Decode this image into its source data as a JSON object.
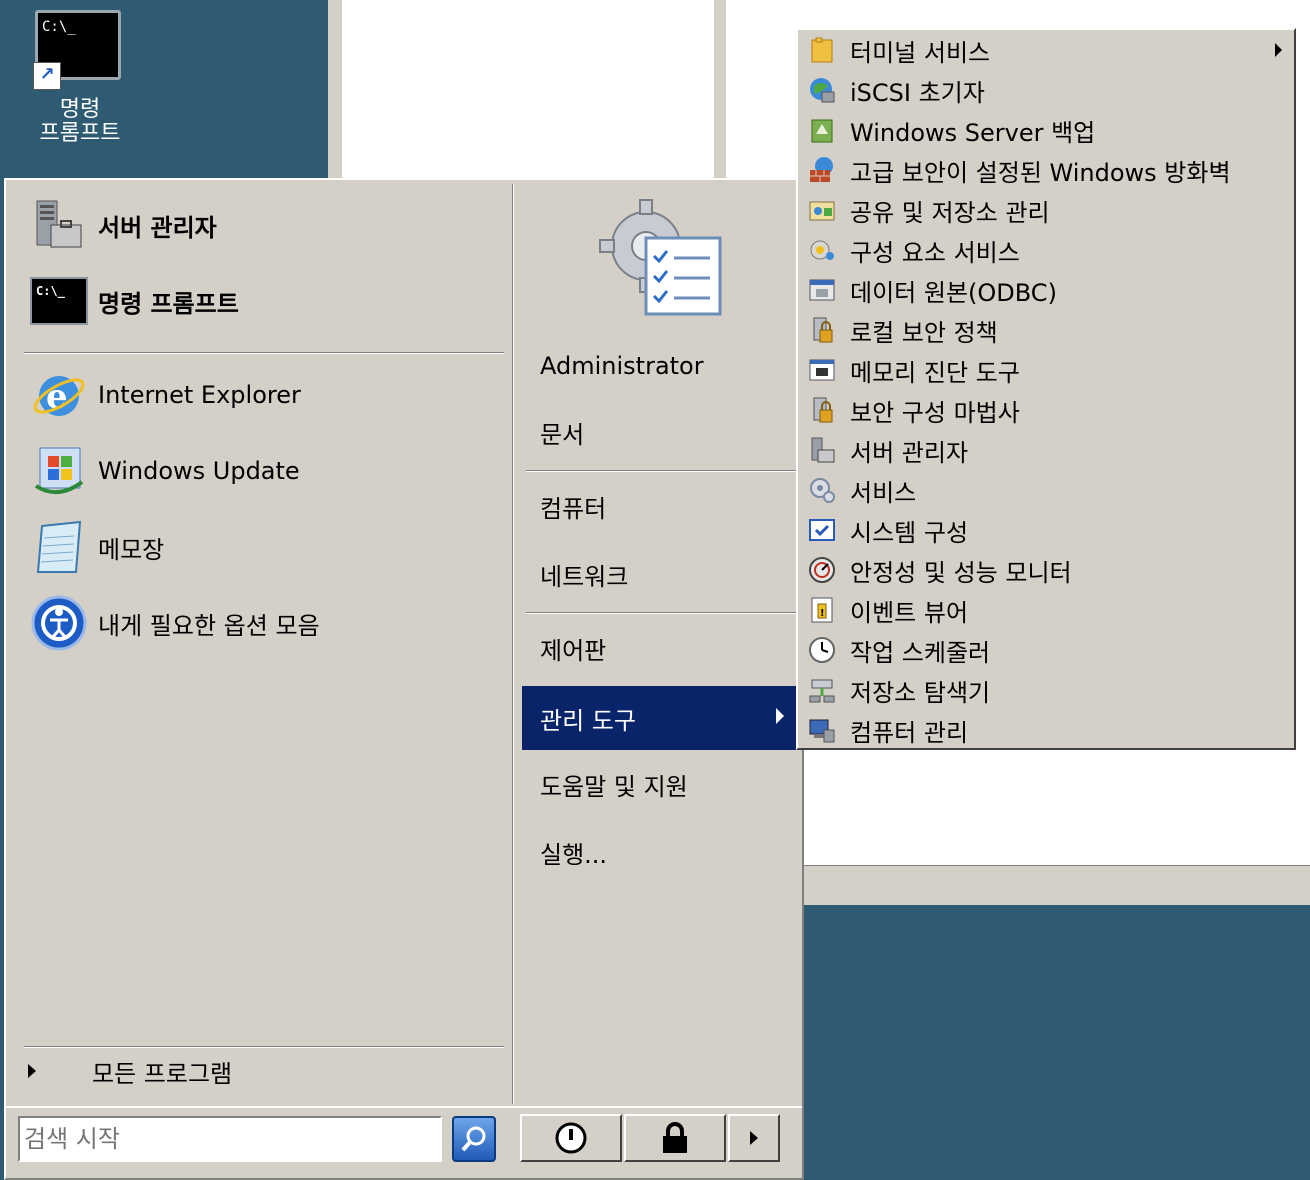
{
  "desktop": {
    "icon_label": "명령\n프롬프트",
    "icon_label_line1": "명령",
    "icon_label_line2": "프롬프트",
    "cmd_prompt_glyph": "C:\\_",
    "colors": {
      "background": "#2e5a72",
      "menu": "#d4d0c8",
      "selection": "#0a246a"
    }
  },
  "start_menu": {
    "pinned": [
      {
        "label": "서버 관리자",
        "icon": "server-manager-icon"
      },
      {
        "label": "명령 프롬프트",
        "icon": "command-prompt-icon"
      }
    ],
    "recent": [
      {
        "label": "Internet Explorer",
        "icon": "internet-explorer-icon"
      },
      {
        "label": "Windows Update",
        "icon": "windows-update-icon"
      },
      {
        "label": "메모장",
        "icon": "notepad-icon"
      },
      {
        "label": "내게 필요한 옵션 모음",
        "icon": "ease-of-access-icon"
      }
    ],
    "all_programs": "모든 프로그램",
    "search_placeholder": "검색 시작",
    "right_pane": {
      "user_icon": "admin-tasks-icon",
      "items": [
        {
          "label": "Administrator"
        },
        {
          "label": "문서"
        },
        {
          "label": "컴퓨터"
        },
        {
          "label": "네트워크"
        },
        {
          "label": "제어판"
        },
        {
          "label": "관리 도구",
          "selected": true,
          "has_submenu": true
        },
        {
          "label": "도움말 및 지원"
        },
        {
          "label": "실행..."
        }
      ]
    },
    "buttons": [
      "power-icon",
      "lock-icon",
      "arrow-right-icon"
    ]
  },
  "admin_tools_menu": {
    "items": [
      {
        "label": "터미널 서비스",
        "icon": "folder-icon",
        "has_submenu": true
      },
      {
        "label": "iSCSI 초기자",
        "icon": "iscsi-icon"
      },
      {
        "label": "Windows Server 백업",
        "icon": "backup-icon"
      },
      {
        "label": "고급 보안이 설정된 Windows 방화벽",
        "icon": "firewall-icon"
      },
      {
        "label": "공유 및 저장소 관리",
        "icon": "share-storage-icon"
      },
      {
        "label": "구성 요소 서비스",
        "icon": "component-services-icon"
      },
      {
        "label": "데이터 원본(ODBC)",
        "icon": "odbc-icon"
      },
      {
        "label": "로컬 보안 정책",
        "icon": "security-policy-icon"
      },
      {
        "label": "메모리 진단 도구",
        "icon": "memory-icon"
      },
      {
        "label": "보안 구성 마법사",
        "icon": "security-wizard-icon"
      },
      {
        "label": "서버 관리자",
        "icon": "server-manager-icon"
      },
      {
        "label": "서비스",
        "icon": "services-icon"
      },
      {
        "label": "시스템 구성",
        "icon": "system-config-icon"
      },
      {
        "label": "안정성 및 성능 모니터",
        "icon": "perf-monitor-icon"
      },
      {
        "label": "이벤트 뷰어",
        "icon": "event-viewer-icon"
      },
      {
        "label": "작업 스케줄러",
        "icon": "task-scheduler-icon"
      },
      {
        "label": "저장소 탐색기",
        "icon": "storage-explorer-icon"
      },
      {
        "label": "컴퓨터 관리",
        "icon": "computer-management-icon"
      }
    ]
  }
}
